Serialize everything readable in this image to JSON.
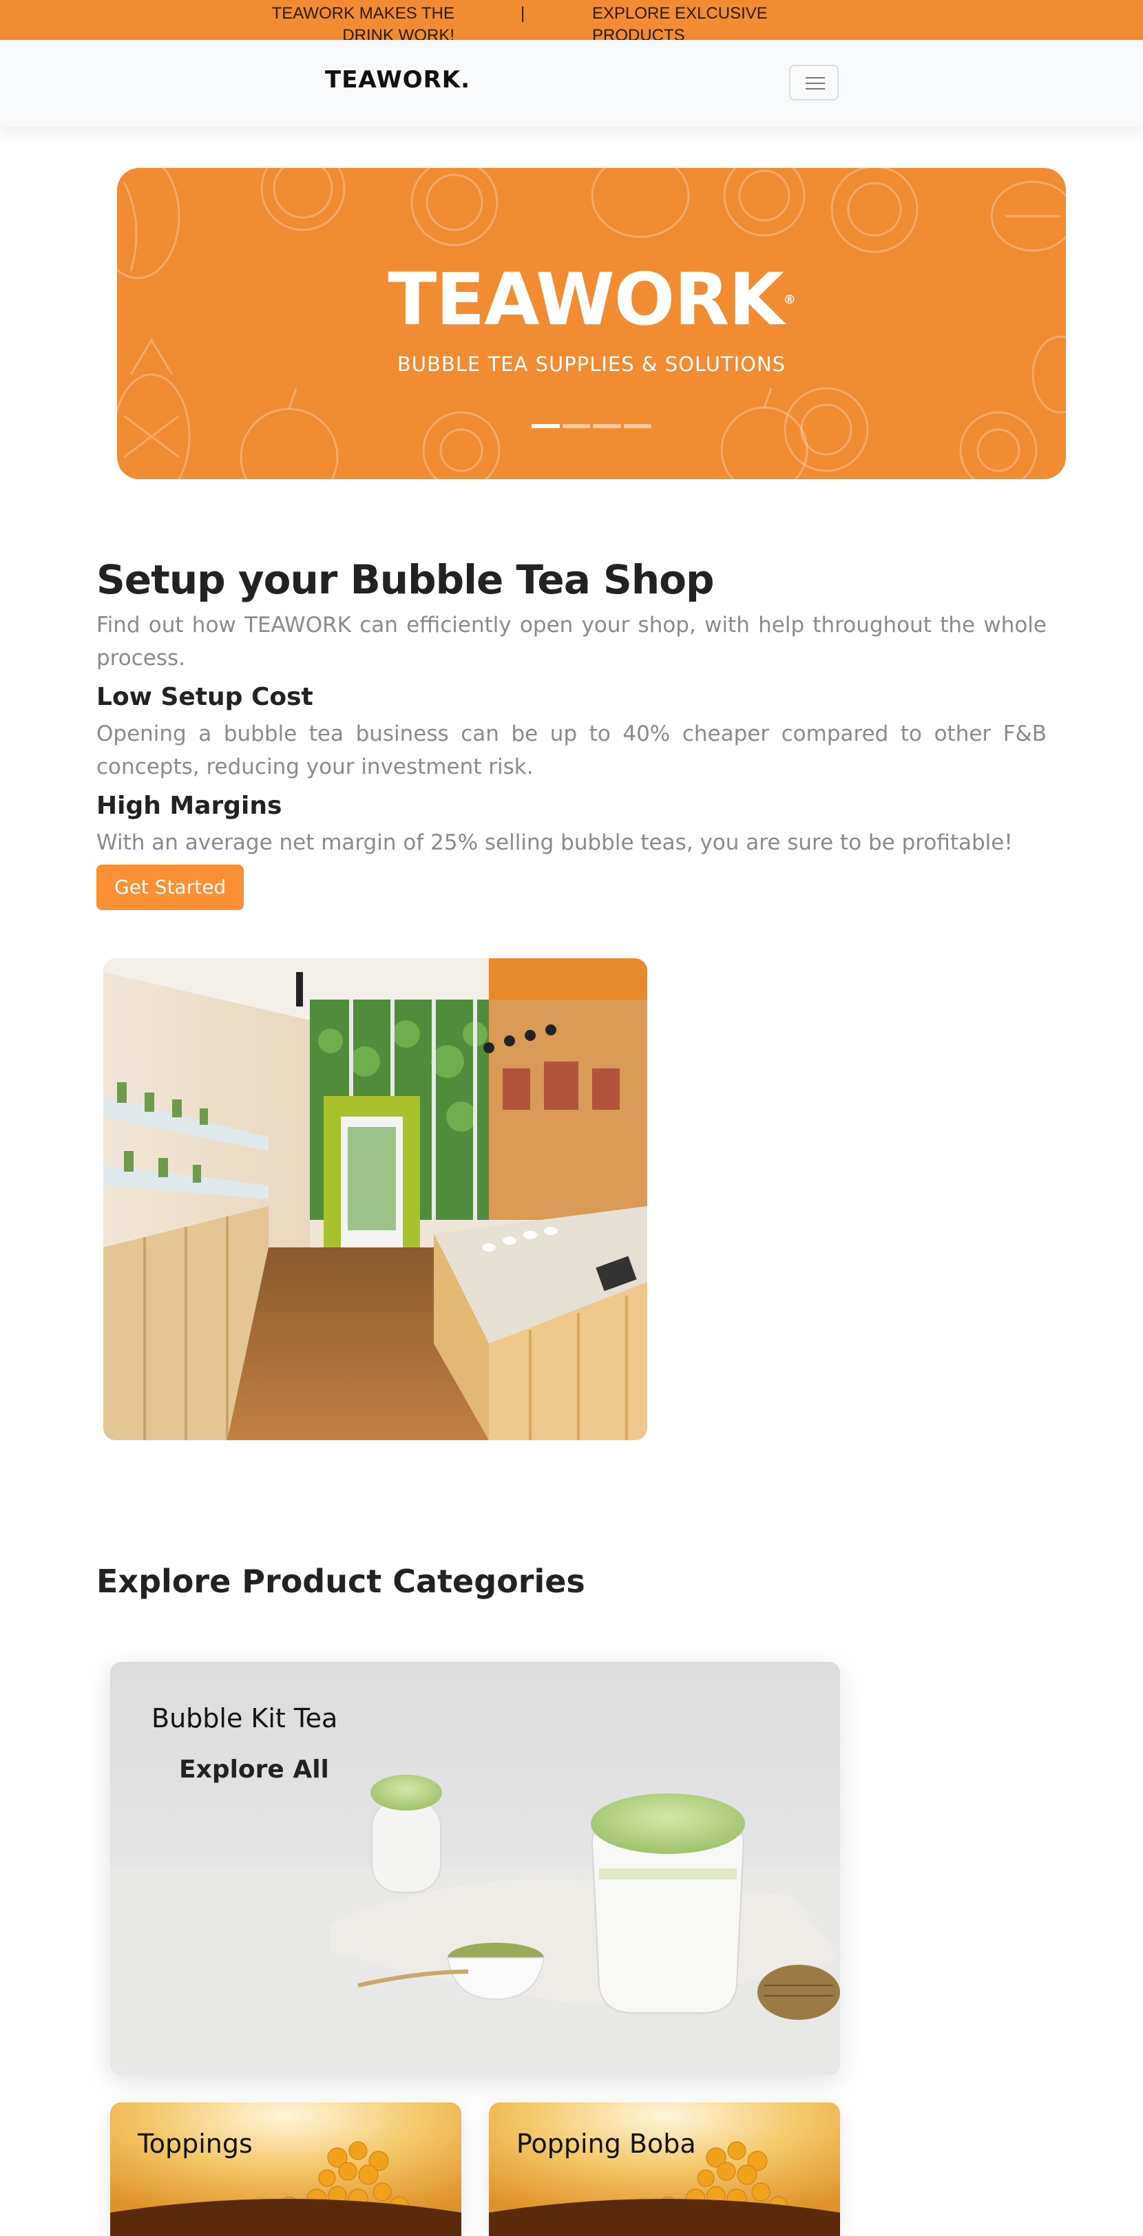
{
  "announcement": {
    "left": "TEAWORK MAKES THE DRINK WORK!",
    "separator": "|",
    "right": "EXPLORE EXLCUSIVE PRODUCTS"
  },
  "navbar": {
    "brand": "TEAWORK.",
    "toggler_icon": "hamburger-menu-icon"
  },
  "hero": {
    "title": "TEAWORK",
    "trademark": "®",
    "subtitle": "BUBBLE TEA SUPPLIES & SOLUTIONS",
    "slides": 4,
    "active_slide": 1,
    "background_color": "#f28c33"
  },
  "setup": {
    "heading": "Setup your Bubble Tea Shop",
    "intro": "Find out how TEAWORK can efficiently open your shop, with help throughout the whole process.",
    "feature1_title": "Low Setup Cost",
    "feature1_text": "Opening a bubble tea business can be up to 40% cheaper compared to other F&B concepts, reducing your investment risk.",
    "feature2_title": "High Margins",
    "feature2_text": "With an average net margin of 25% selling bubble teas, you are sure to be profitable!",
    "cta": "Get Started"
  },
  "categories": {
    "heading": "Explore Product Categories",
    "main": {
      "label": "Bubble Kit Tea",
      "link": "Explore All"
    },
    "toppings": {
      "label": "Toppings"
    },
    "popping": {
      "label": "Popping Boba"
    }
  },
  "colors": {
    "brand_orange": "#f28c33",
    "button_orange": "#fb8f35"
  }
}
